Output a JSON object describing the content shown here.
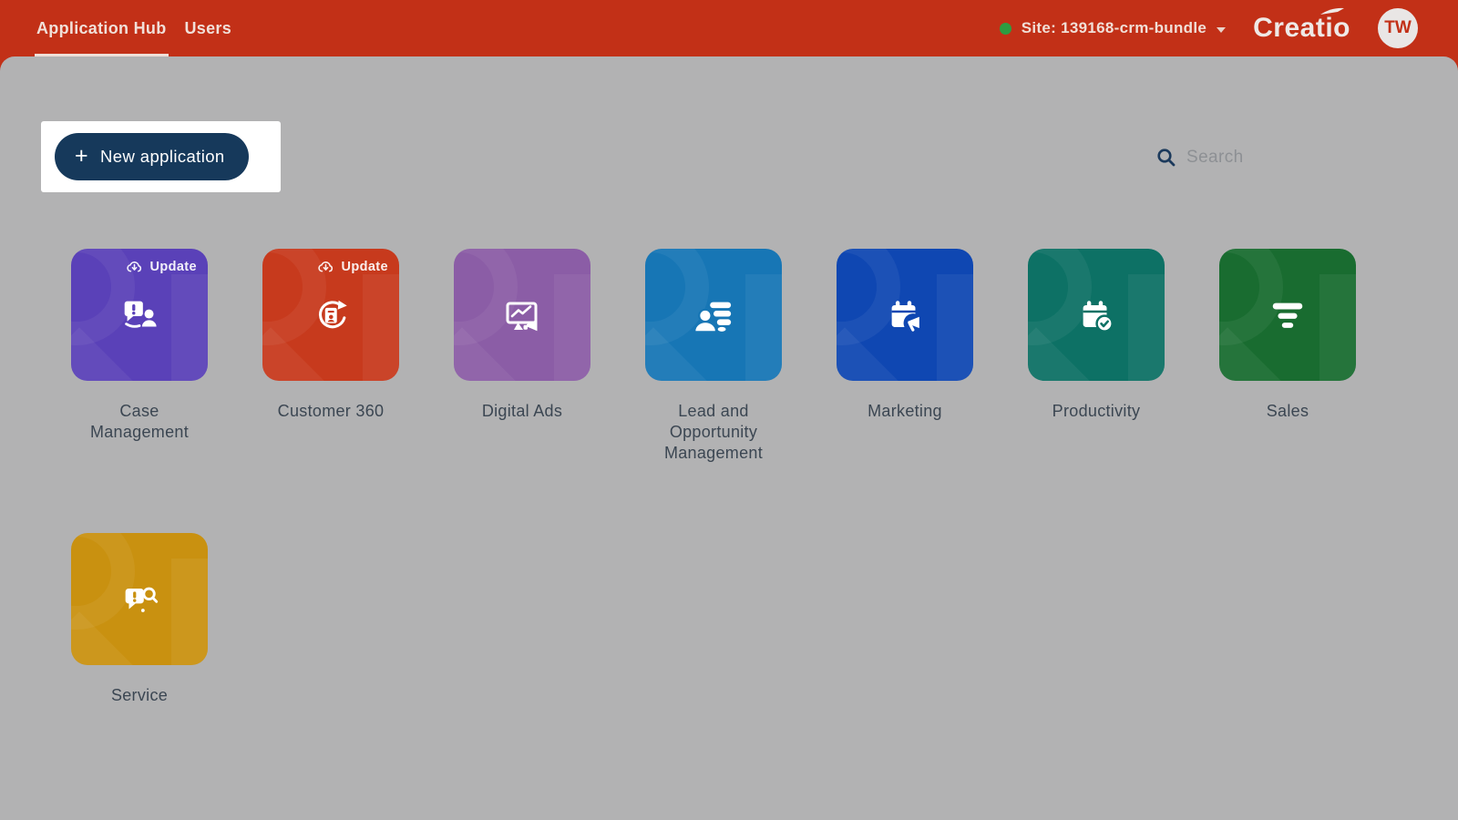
{
  "header": {
    "tabs": [
      {
        "label": "Application Hub",
        "active": true
      },
      {
        "label": "Users",
        "active": false
      }
    ],
    "site": {
      "status_color": "#2D9C41",
      "label": "Site: 139168-crm-bundle"
    },
    "logo_text": "Creatio",
    "avatar_initials": "TW"
  },
  "toolbar": {
    "new_app_label": "New application",
    "search_placeholder": "Search"
  },
  "update_badge_label": "Update",
  "apps": [
    {
      "name": "Case Management",
      "color": "#5A41B8",
      "icon": "chat-alert-person-icon",
      "update": true
    },
    {
      "name": "Customer 360",
      "color": "#C73A1D",
      "icon": "refresh-contact-icon",
      "update": true
    },
    {
      "name": "Digital Ads",
      "color": "#8B5DA6",
      "icon": "monitor-megaphone-icon",
      "update": false
    },
    {
      "name": "Lead and Opportunity Management",
      "color": "#1776B5",
      "icon": "funnel-person-icon",
      "update": false
    },
    {
      "name": "Marketing",
      "color": "#0F47B2",
      "icon": "calendar-megaphone-icon",
      "update": false
    },
    {
      "name": "Productivity",
      "color": "#0D7165",
      "icon": "calendar-check-icon",
      "update": false
    },
    {
      "name": "Sales",
      "color": "#196C30",
      "icon": "funnel-icon",
      "update": false
    },
    {
      "name": "Service",
      "color": "#C99110",
      "icon": "chat-alert-search-icon",
      "update": false
    }
  ],
  "colors": {
    "header_bg": "#C23017",
    "panel_bg": "#B2B2B3",
    "button_bg": "#16395B",
    "spotlight_bg": "#FFFFFF",
    "label_text": "#3B4652"
  }
}
